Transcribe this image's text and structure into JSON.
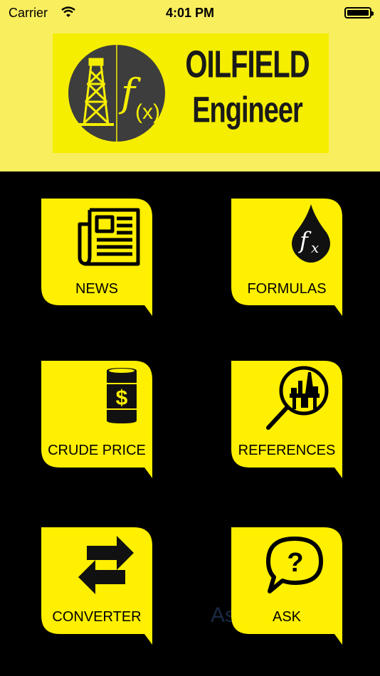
{
  "status_bar": {
    "carrier": "Carrier",
    "time": "4:01 PM"
  },
  "logo": {
    "line1": "OILFIELD",
    "line2": "Engineer"
  },
  "menu": {
    "news": "NEWS",
    "formulas": "FORMULAS",
    "crude_price": "CRUDE PRICE",
    "references": "REFERENCES",
    "converter": "CONVERTER",
    "ask": "ASK"
  },
  "watermark": "As          on",
  "colors": {
    "header_bg": "#f8ee5e",
    "tile_bg": "#ffef00",
    "page_bg": "#000000"
  }
}
